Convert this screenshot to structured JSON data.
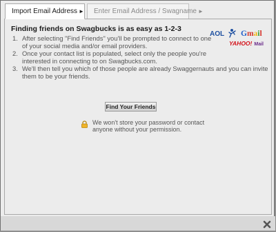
{
  "tabs": {
    "active_label": "Import Email Address",
    "inactive_label": "Enter Email Address / Swagname"
  },
  "main": {
    "heading": "Finding friends on Swagbucks is as easy as 1-2-3",
    "steps": [
      {
        "num": "1.",
        "text": "After selecting \"Find Friends\" you'll be prompted to connect to one of your social media and/or email providers."
      },
      {
        "num": "2.",
        "text": "Once your contact list is populated, select only the people you're interested in connecting to on Swagbucks.com."
      },
      {
        "num": "3.",
        "text": "We'll then tell you which of those people are already Swaggernauts and you can invite them to be your friends."
      }
    ],
    "find_button": "Find Your Friends",
    "privacy_note": "We won't store your password or contact anyone without your permission."
  },
  "providers": {
    "aol": "AOL",
    "gmail": [
      "G",
      "m",
      "a",
      "i",
      "l"
    ],
    "yahoo": "YAHOO!",
    "yahoo_mail": "Mail"
  },
  "colors": {
    "frame_bg": "#ececec",
    "aol_blue": "#1d4fa0",
    "yahoo_red": "#d4121a"
  },
  "icons": {
    "close": "close-icon",
    "lock": "lock-icon",
    "aol": "aol-running-man-icon"
  }
}
